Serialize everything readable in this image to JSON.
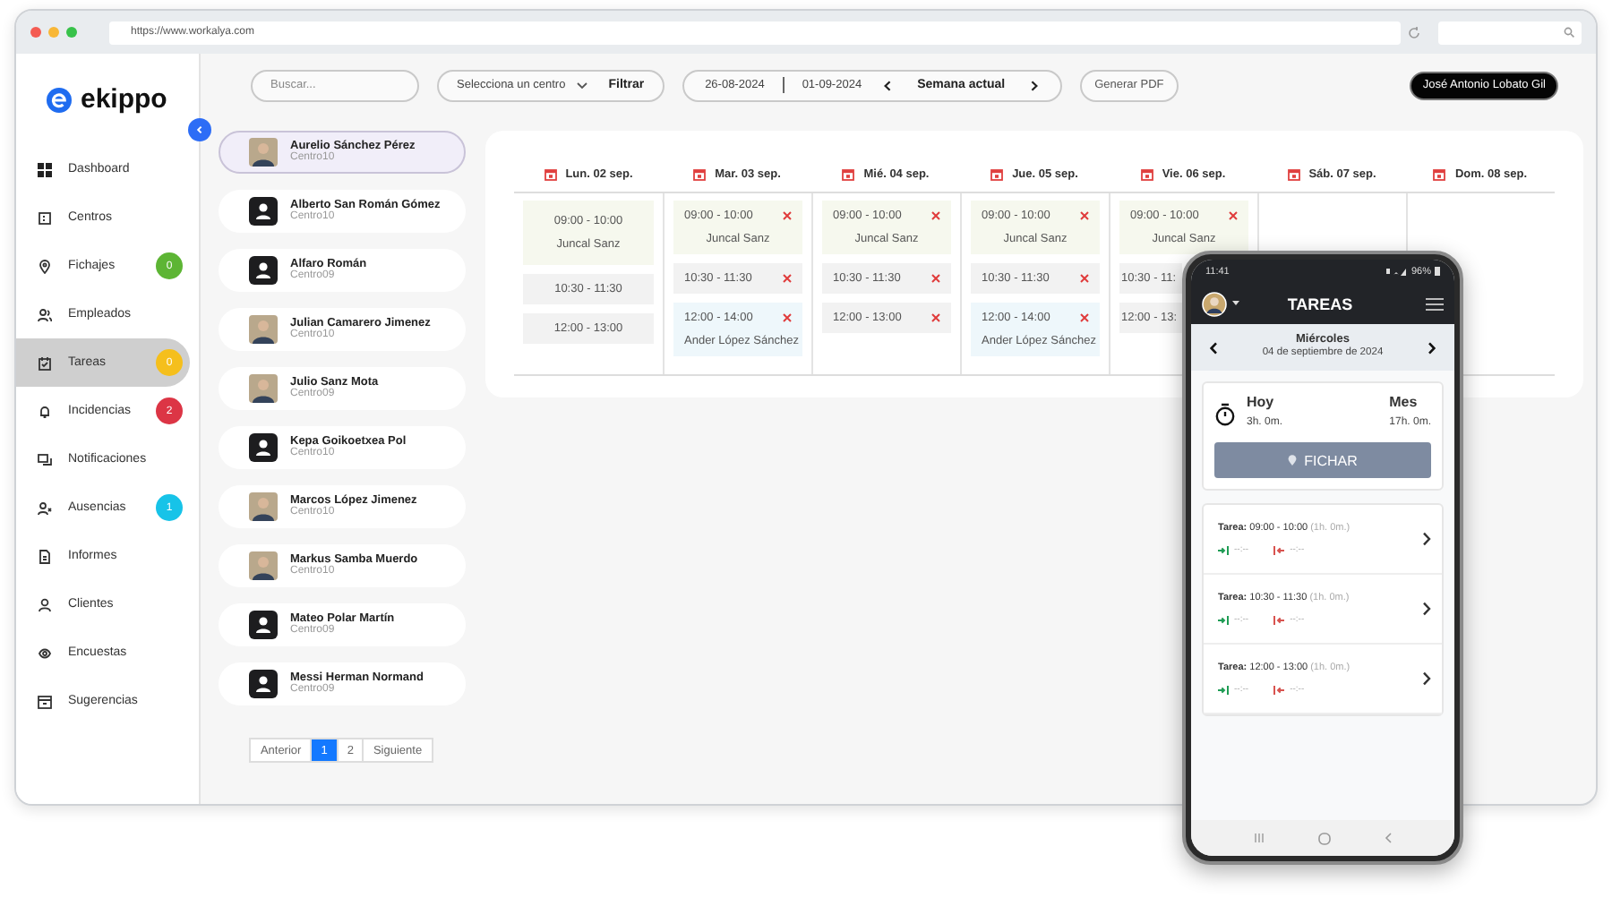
{
  "browser": {
    "url": "https://www.workalya.com"
  },
  "brand": {
    "name": "ekippo"
  },
  "sidebar": {
    "items": [
      {
        "label": "Dashboard",
        "selected": false
      },
      {
        "label": "Centros",
        "selected": false
      },
      {
        "label": "Fichajes",
        "selected": false,
        "badge": "0",
        "color": "#5db534"
      },
      {
        "label": "Empleados",
        "selected": false
      },
      {
        "label": "Tareas",
        "selected": true,
        "badge": "0",
        "color": "#f5bf1c"
      },
      {
        "label": "Incidencias",
        "selected": false,
        "badge": "2",
        "color": "#dc3545"
      },
      {
        "label": "Notificaciones",
        "selected": false
      },
      {
        "label": "Ausencias",
        "selected": false,
        "badge": "1",
        "color": "#17c3e8"
      },
      {
        "label": "Informes",
        "selected": false
      },
      {
        "label": "Clientes",
        "selected": false
      },
      {
        "label": "Encuestas",
        "selected": false
      },
      {
        "label": "Sugerencias",
        "selected": false
      }
    ]
  },
  "toolbar": {
    "search": {
      "placeholder": "Buscar..."
    },
    "center_select": "Selecciona un centro",
    "filter_button": "Filtrar",
    "date_from": "26-08-2024",
    "date_to": "01-09-2024",
    "week_label": "Semana actual",
    "pdf_button": "Generar PDF",
    "user_button": "José Antonio Lobato Gil"
  },
  "employees": [
    {
      "kind": "photo",
      "name": "Aurelio Sánchez Pérez",
      "center": "Centro10",
      "selected": true
    },
    {
      "kind": "default",
      "name": "Alberto San Román Gómez",
      "center": "Centro10",
      "selected": false
    },
    {
      "kind": "default",
      "name": "Alfaro Román",
      "center": "Centro09",
      "selected": false
    },
    {
      "kind": "photo",
      "name": "Julian Camarero Jimenez",
      "center": "Centro10",
      "selected": false
    },
    {
      "kind": "photo",
      "name": "Julio Sanz Mota",
      "center": "Centro09",
      "selected": false
    },
    {
      "kind": "default",
      "name": "Kepa Goikoetxea Pol",
      "center": "Centro10",
      "selected": false
    },
    {
      "kind": "photo",
      "name": "Marcos López Jimenez",
      "center": "Centro10",
      "selected": false
    },
    {
      "kind": "photo",
      "name": "Markus Samba Muerdo",
      "center": "Centro10",
      "selected": false
    },
    {
      "kind": "default",
      "name": "Mateo Polar Martín",
      "center": "Centro09",
      "selected": false
    },
    {
      "kind": "default",
      "name": "Messi Herman Normand",
      "center": "Centro09",
      "selected": false
    }
  ],
  "pagination": [
    {
      "label": "Anterior",
      "selected": false
    },
    {
      "label": "1",
      "selected": true
    },
    {
      "label": "2",
      "selected": false
    },
    {
      "label": "Siguiente",
      "selected": false
    }
  ],
  "calendar": {
    "days": [
      {
        "label": "Lun. 02 sep.",
        "slots": [
          {
            "kind": "assigned",
            "time": "09:00 - 10:00",
            "person": "Juncal Sanz",
            "removable": false
          },
          {
            "kind": "free",
            "time": "10:30 - 11:30",
            "removable": false
          },
          {
            "kind": "free",
            "time": "12:00 - 13:00",
            "removable": false
          }
        ]
      },
      {
        "label": "Mar. 03 sep.",
        "slots": [
          {
            "kind": "assigned",
            "time": "09:00 - 10:00",
            "person": "Juncal Sanz",
            "removable": true
          },
          {
            "kind": "free",
            "time": "10:30 - 11:30",
            "removable": true
          },
          {
            "kind": "other",
            "time": "12:00 - 14:00",
            "person": "Ander López Sánchez",
            "removable": true
          }
        ]
      },
      {
        "label": "Mié. 04 sep.",
        "slots": [
          {
            "kind": "assigned",
            "time": "09:00 - 10:00",
            "person": "Juncal Sanz",
            "removable": true
          },
          {
            "kind": "free",
            "time": "10:30 - 11:30",
            "removable": true
          },
          {
            "kind": "free",
            "time": "12:00 - 13:00",
            "removable": true
          }
        ]
      },
      {
        "label": "Jue. 05 sep.",
        "slots": [
          {
            "kind": "assigned",
            "time": "09:00 - 10:00",
            "person": "Juncal Sanz",
            "removable": true
          },
          {
            "kind": "free",
            "time": "10:30 - 11:30",
            "removable": true
          },
          {
            "kind": "other",
            "time": "12:00 - 14:00",
            "person": "Ander López Sánchez",
            "removable": true
          }
        ]
      },
      {
        "label": "Vie. 06 sep.",
        "slots": [
          {
            "kind": "assigned",
            "time": "09:00 - 10:00",
            "person": "Juncal Sanz",
            "removable": true
          },
          {
            "kind": "free",
            "time": "10:30 - 11:",
            "removable": false,
            "cut": true
          },
          {
            "kind": "free",
            "time": "12:00 - 13:",
            "removable": false,
            "cut": true
          }
        ]
      },
      {
        "label": "Sáb. 07 sep."
      },
      {
        "label": "Dom. 08 sep."
      }
    ]
  },
  "phone": {
    "status_time": "11:41",
    "battery": "96%",
    "title": "TAREAS",
    "day": "Miércoles",
    "date": "04 de septiembre de 2024",
    "today_label": "Hoy",
    "today_value": "3h. 0m.",
    "month_label": "Mes",
    "month_value": "17h. 0m.",
    "clock_button": "FICHAR",
    "tasks": [
      {
        "label": "Tarea:",
        "time": "09:00 - 10:00",
        "duration": "(1h. 0m.)",
        "check_in": "--:--",
        "check_out": "--:--"
      },
      {
        "label": "Tarea:",
        "time": "10:30 - 11:30",
        "duration": "(1h. 0m.)",
        "check_in": "--:--",
        "check_out": "--:--"
      },
      {
        "label": "Tarea:",
        "time": "12:00 - 13:00",
        "duration": "(1h. 0m.)",
        "check_in": "--:--",
        "check_out": "--:--"
      }
    ]
  }
}
